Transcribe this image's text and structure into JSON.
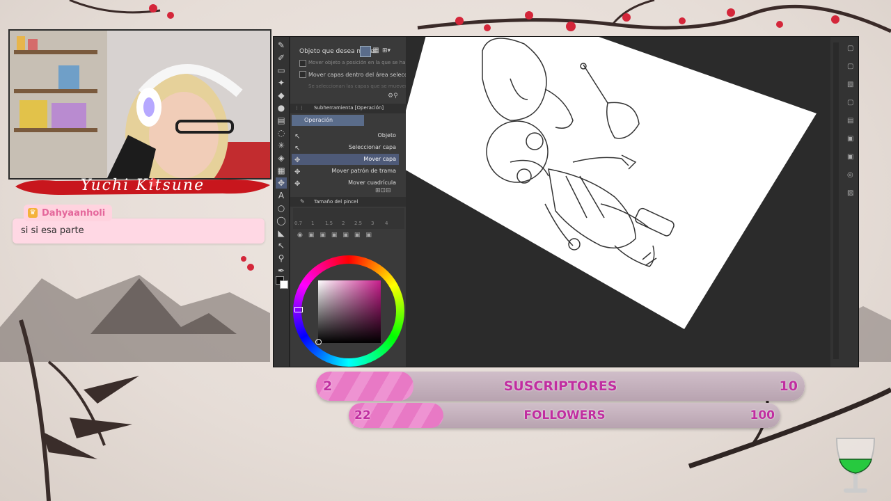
{
  "streamer": {
    "name": "Yuchi Kitsune"
  },
  "chat": {
    "username": "Dahyaanholi",
    "message": "si si esa parte"
  },
  "app": {
    "tool_property": {
      "object_label": "Objeto que desea mover",
      "opt1": "Mover objeto a posición en la que se ha hecho clic",
      "opt2": "Mover capas dentro del área seleccionada",
      "hint": "Se seleccionan las capas que se mueven"
    },
    "subtool": {
      "header": "Subherramienta [Operación]",
      "tab": "Operación",
      "items": [
        "Objeto",
        "Seleccionar capa",
        "Mover capa",
        "Mover patrón de trama",
        "Mover cuadrícula"
      ],
      "selected_index": 2
    },
    "brush_size": {
      "header": "Tamaño del pincel",
      "values": [
        "0.7",
        "1",
        "1.5",
        "2",
        "2.5",
        "3",
        "4"
      ]
    }
  },
  "goals": {
    "subscribers": {
      "label": "SUSCRIPTORES",
      "current": "2",
      "target": "10",
      "progress": 0.2
    },
    "followers": {
      "label": "FOLLOWERS",
      "current": "22",
      "target": "100",
      "progress": 0.22
    }
  },
  "colors": {
    "accent_pink": "#e879c5",
    "goal_text": "#c02ea0",
    "banner_red": "#c8161d"
  }
}
